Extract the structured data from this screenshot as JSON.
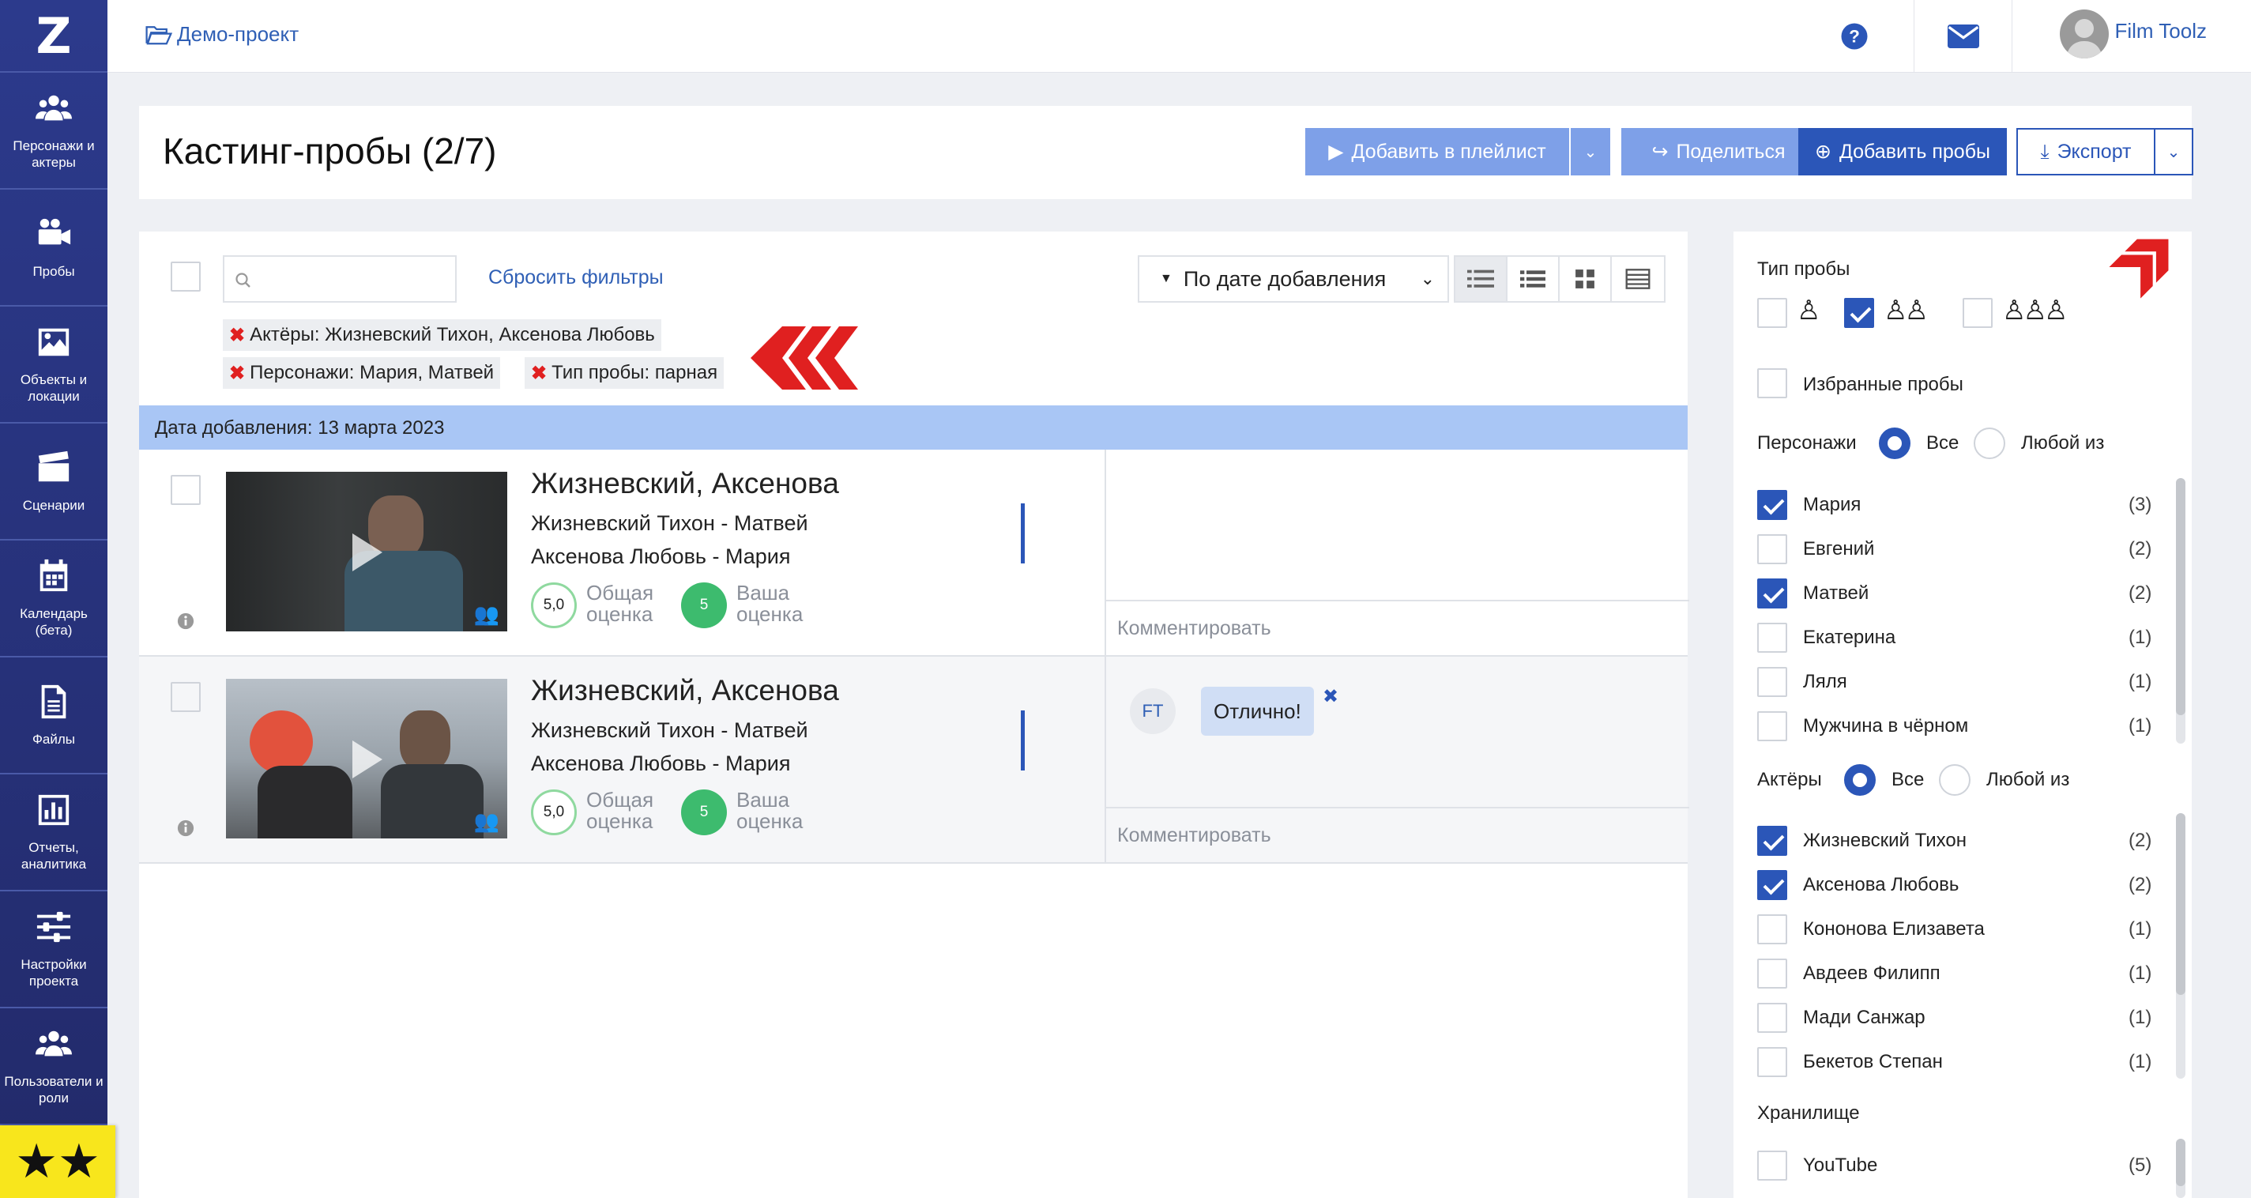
{
  "sidebar": {
    "items": [
      {
        "label": "Персонажи и актеры",
        "icon": "users-icon"
      },
      {
        "label": "Пробы",
        "icon": "camera-icon"
      },
      {
        "label": "Объекты и локации",
        "icon": "image-icon"
      },
      {
        "label": "Сценарии",
        "icon": "clapper-icon"
      },
      {
        "label": "Календарь (бета)",
        "icon": "calendar-icon"
      },
      {
        "label": "Файлы",
        "icon": "file-icon"
      },
      {
        "label": "Отчеты, аналитика",
        "icon": "chart-icon"
      },
      {
        "label": "Настройки проекта",
        "icon": "sliders-icon"
      },
      {
        "label": "Пользователи и роли",
        "icon": "users-icon"
      }
    ]
  },
  "topbar": {
    "project": "Демо-проект",
    "user": "Film Toolz"
  },
  "header": {
    "title": "Кастинг-пробы (2/7)",
    "add_playlist": "Добавить в плейлист",
    "share": "Поделиться",
    "add_tests": "Добавить пробы",
    "export": "Экспорт"
  },
  "list": {
    "reset_filters": "Сбросить фильтры",
    "sort": "По дате добавления",
    "tags": [
      {
        "key": "Актёры:",
        "value": "Жизневский Тихон, Аксенова Любовь"
      },
      {
        "key": "Персонажи:",
        "value": "Мария, Матвей"
      },
      {
        "key": "Тип пробы:",
        "value": "парная"
      }
    ],
    "group_header": "Дата добавления: 13 марта 2023",
    "rows": [
      {
        "title": "Жизневский, Аксенова",
        "line1": "Жизневский Тихон - Матвей",
        "line2": "Аксенова Любовь - Мария",
        "overall": "5,0",
        "overall_label": "Общая оценка",
        "yours": "5",
        "yours_label": "Ваша оценка",
        "comment_link": "Комментировать"
      },
      {
        "title": "Жизневский, Аксенова",
        "line1": "Жизневский Тихон - Матвей",
        "line2": "Аксенова Любовь - Мария",
        "overall": "5,0",
        "overall_label": "Общая оценка",
        "yours": "5",
        "yours_label": "Ваша оценка",
        "comment_link": "Комментировать",
        "comment": {
          "initials": "FT",
          "text": "Отлично!"
        }
      }
    ]
  },
  "filters": {
    "type_title": "Тип пробы",
    "favorites": "Избранные пробы",
    "characters_title": "Персонажи",
    "all": "Все",
    "any": "Любой из",
    "characters": [
      {
        "name": "Мария",
        "count": "(3)",
        "checked": true
      },
      {
        "name": "Евгений",
        "count": "(2)",
        "checked": false
      },
      {
        "name": "Матвей",
        "count": "(2)",
        "checked": true
      },
      {
        "name": "Екатерина",
        "count": "(1)",
        "checked": false
      },
      {
        "name": "Ляля",
        "count": "(1)",
        "checked": false
      },
      {
        "name": "Мужчина в чёрном",
        "count": "(1)",
        "checked": false
      }
    ],
    "actors_title": "Актёры",
    "actors": [
      {
        "name": "Жизневский Тихон",
        "count": "(2)",
        "checked": true
      },
      {
        "name": "Аксенова Любовь",
        "count": "(2)",
        "checked": true
      },
      {
        "name": "Кононова Елизавета",
        "count": "(1)",
        "checked": false
      },
      {
        "name": "Авдеев Филипп",
        "count": "(1)",
        "checked": false
      },
      {
        "name": "Мади Санжар",
        "count": "(1)",
        "checked": false
      },
      {
        "name": "Бекетов Степан",
        "count": "(1)",
        "checked": false
      }
    ],
    "storage_title": "Хранилище",
    "storage": [
      {
        "name": "YouTube",
        "count": "(5)",
        "checked": false
      }
    ]
  },
  "colors": {
    "accent": "#2b56b8",
    "button_light": "#7ea0e8",
    "group_bar": "#a9c6f5",
    "green": "#3dbb6e",
    "arrow": "#e02020",
    "sidebar": "#26307a",
    "highlight": "#f8e61c"
  }
}
